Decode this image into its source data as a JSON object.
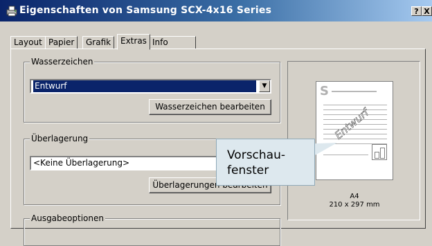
{
  "window": {
    "title": "Eigenschaften von Samsung SCX-4x16 Series",
    "help_button": "?",
    "close_button": "X"
  },
  "tabs": [
    {
      "label": "Layout",
      "active": false
    },
    {
      "label": "Papier",
      "active": false
    },
    {
      "label": "Grafik",
      "active": false
    },
    {
      "label": "Extras",
      "active": true
    },
    {
      "label": "Info",
      "active": false
    }
  ],
  "watermark": {
    "legend": "Wasserzeichen",
    "selected": "Entwurf",
    "edit_button": "Wasserzeichen bearbeiten"
  },
  "overlay": {
    "legend": "Überlagerung",
    "selected": "<Keine Überlagerung>",
    "edit_button": "Überlagerungen bearbeiten"
  },
  "output_options": {
    "legend": "Ausgabeoptionen"
  },
  "preview": {
    "watermark_text": "Entwurf",
    "page_letter": "S",
    "paper_name": "A4",
    "paper_size": "210 x 297 mm"
  },
  "callout": {
    "line1": "Vorschau-",
    "line2": "fenster"
  },
  "colors": {
    "titlebar_start": "#0a246a",
    "titlebar_end": "#a6caf0",
    "selection": "#0a246a",
    "callout_bg": "#dde8ee"
  }
}
